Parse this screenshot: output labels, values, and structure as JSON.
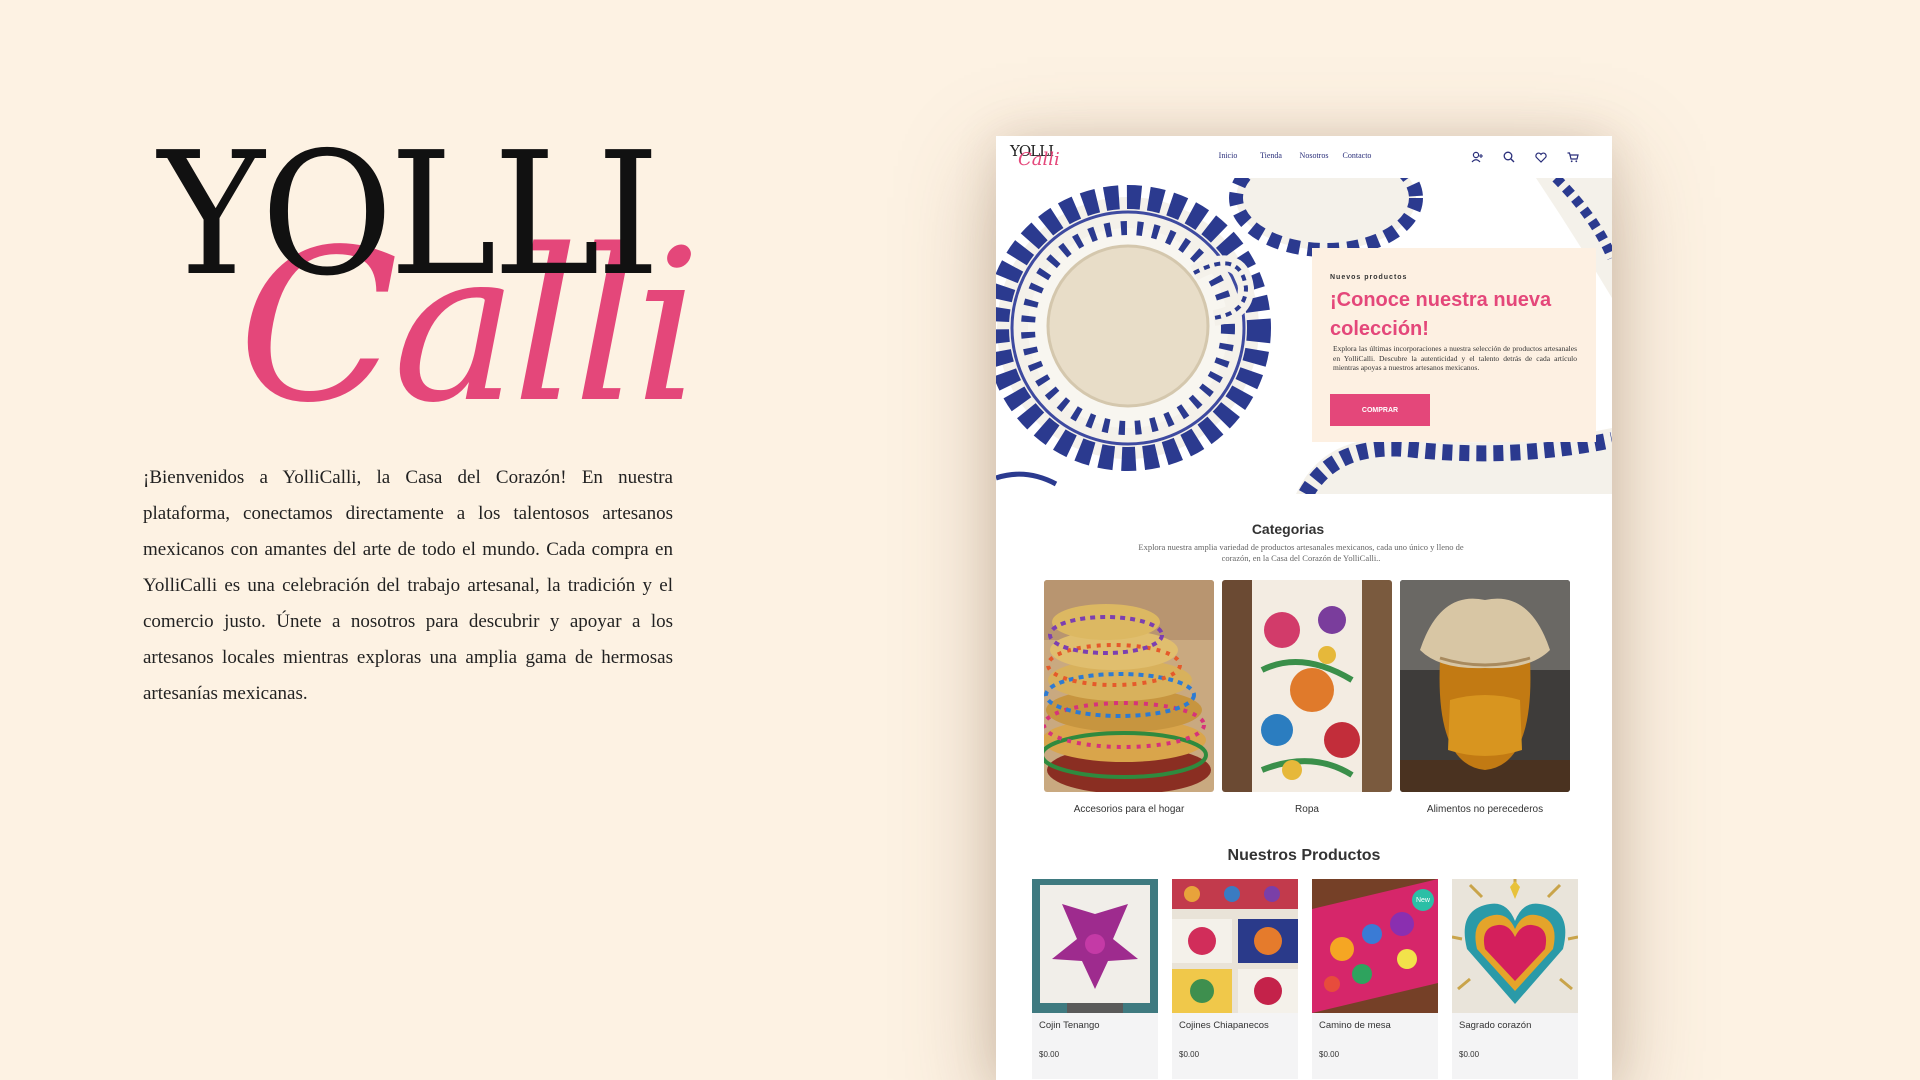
{
  "brand": {
    "logo_top": "YOLLI",
    "logo_script": "Calli"
  },
  "intro": {
    "text": "¡Bienvenidos a YolliCalli, la Casa del Corazón! En nuestra plataforma, conectamos directamente a los talentosos artesanos mexicanos con amantes del arte de todo el mundo. Cada compra en YolliCalli es una celebración del trabajo artesanal, la tradición y el comercio justo. Únete a nosotros para descubrir y apoyar a los artesanos locales mientras exploras una amplia gama de hermosas artesanías mexicanas."
  },
  "site": {
    "nav": {
      "logo_top": "YOLLI",
      "logo_script": "Calli",
      "links": [
        "Inicio",
        "Tienda",
        "Nosotros",
        "Contacto"
      ],
      "icons": [
        "user-add-icon",
        "search-icon",
        "heart-icon",
        "cart-icon"
      ]
    },
    "hero": {
      "eyebrow": "Nuevos productos",
      "title": "¡Conoce nuestra nueva colección!",
      "description": "Explora las últimas incorporaciones a nuestra selección de productos artesanales en YolliCalli. Descubre la autenticidad y el talento detrás de cada artículo mientras apoyas a nuestros artesanos mexicanos.",
      "button": "COMPRAR"
    },
    "categories": {
      "title": "Categorias",
      "description": "Explora nuestra amplia variedad de productos artesanales mexicanos, cada uno único y lleno de corazón, en la Casa del Corazón de YolliCalli..",
      "items": [
        {
          "label": "Accesorios para el hogar"
        },
        {
          "label": "Ropa"
        },
        {
          "label": "Alimentos no perecederos"
        }
      ]
    },
    "products": {
      "title": "Nuestros Productos",
      "items": [
        {
          "name": "Cojin Tenango",
          "price": "$0.00"
        },
        {
          "name": "Cojines Chiapanecos",
          "price": "$0.00"
        },
        {
          "name": "Camino de mesa",
          "price": "$0.00",
          "badge": "New"
        },
        {
          "name": "Sagrado corazón",
          "price": "$0.00"
        }
      ]
    }
  },
  "colors": {
    "background": "#fdf2e3",
    "accent_pink": "#e4477a",
    "nav_blue": "#2a2f7a",
    "badge_teal": "#2bbfa6"
  }
}
